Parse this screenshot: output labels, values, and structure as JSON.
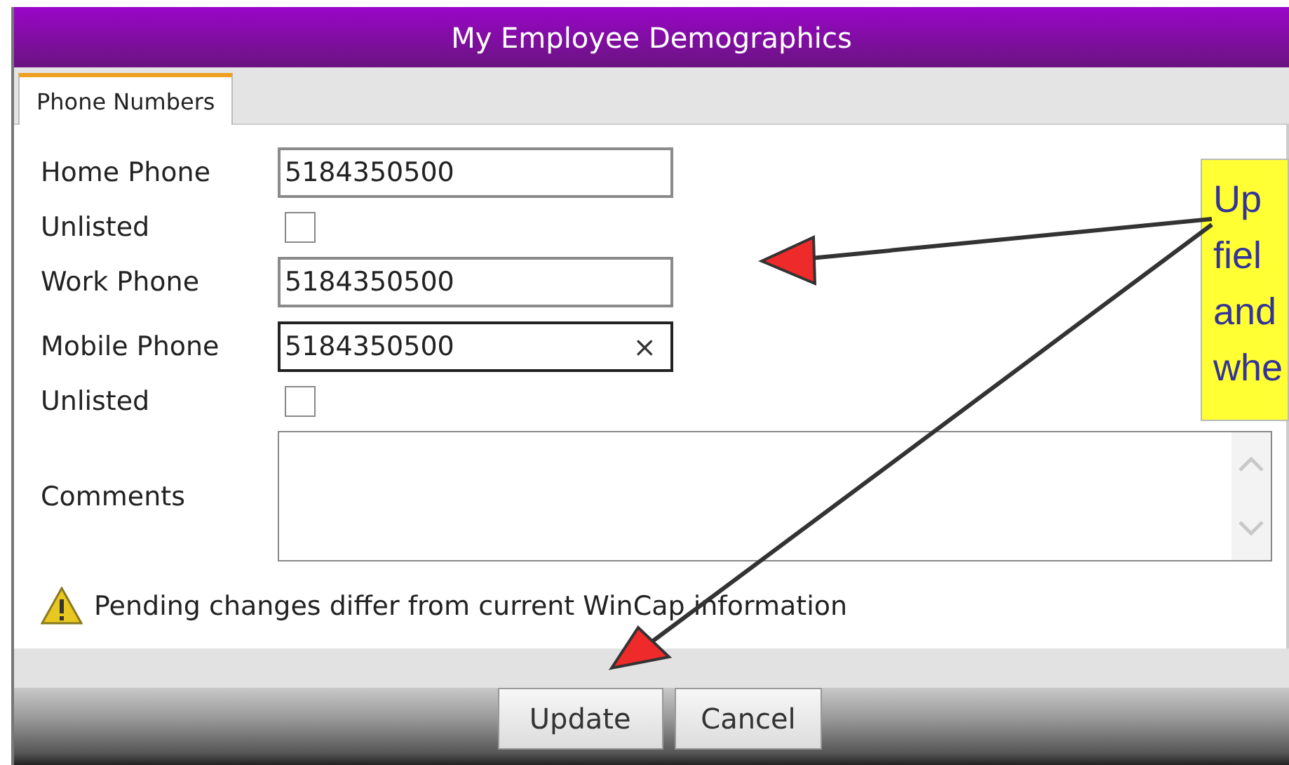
{
  "window": {
    "title": "My Employee Demographics"
  },
  "tabs": [
    {
      "label": "Phone Numbers",
      "selected": true
    }
  ],
  "form": {
    "rows": [
      {
        "kind": "text",
        "label": "Home Phone",
        "value": "5184350500",
        "focused": false
      },
      {
        "kind": "checkbox",
        "label": "Unlisted",
        "checked": false
      },
      {
        "kind": "text",
        "label": "Work Phone",
        "value": "5184350500",
        "focused": false
      },
      {
        "kind": "text",
        "label": "Mobile Phone",
        "value": "5184350500",
        "focused": true,
        "clear_button": "×"
      },
      {
        "kind": "checkbox",
        "label": "Unlisted",
        "checked": false
      },
      {
        "kind": "textarea",
        "label": "Comments"
      }
    ]
  },
  "warning": "Pending changes differ from current WinCap information",
  "callout": {
    "lines": [
      "Up",
      "fiel",
      "and",
      "whe"
    ]
  },
  "buttons": [
    "Update",
    "Cancel"
  ]
}
